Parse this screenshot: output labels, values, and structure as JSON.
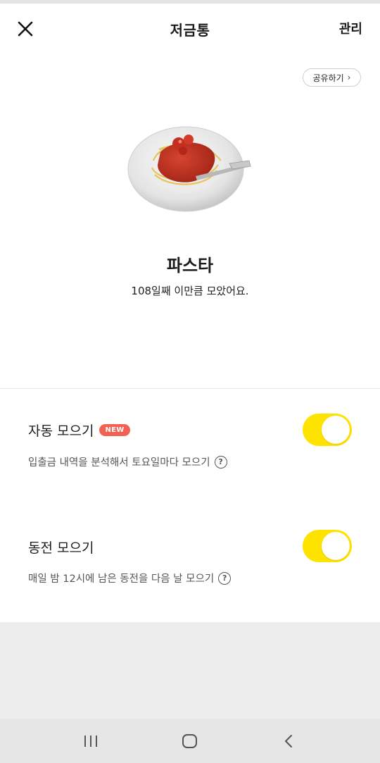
{
  "header": {
    "title": "저금통",
    "manage_label": "관리",
    "close_icon": "close-icon"
  },
  "share": {
    "label": "공유하기",
    "chevron": "›"
  },
  "item": {
    "image_icon": "pasta-plate-illustration",
    "name": "파스타",
    "subtitle": "108일째 이만큼 모았어요."
  },
  "settings": [
    {
      "title": "자동 모으기",
      "badge": "NEW",
      "description": "입출금 내역을 분석해서 토요일마다 모으기",
      "help": "?",
      "enabled": true
    },
    {
      "title": "동전 모으기",
      "description": "매일 밤 12시에 남은 동전을 다음 날 모으기",
      "help": "?",
      "enabled": true
    }
  ],
  "colors": {
    "toggle_on": "#ffe300",
    "badge": "#f26254",
    "background": "#ededed"
  },
  "navbar": {
    "icons": [
      "recent-apps-icon",
      "home-icon",
      "back-icon"
    ]
  }
}
